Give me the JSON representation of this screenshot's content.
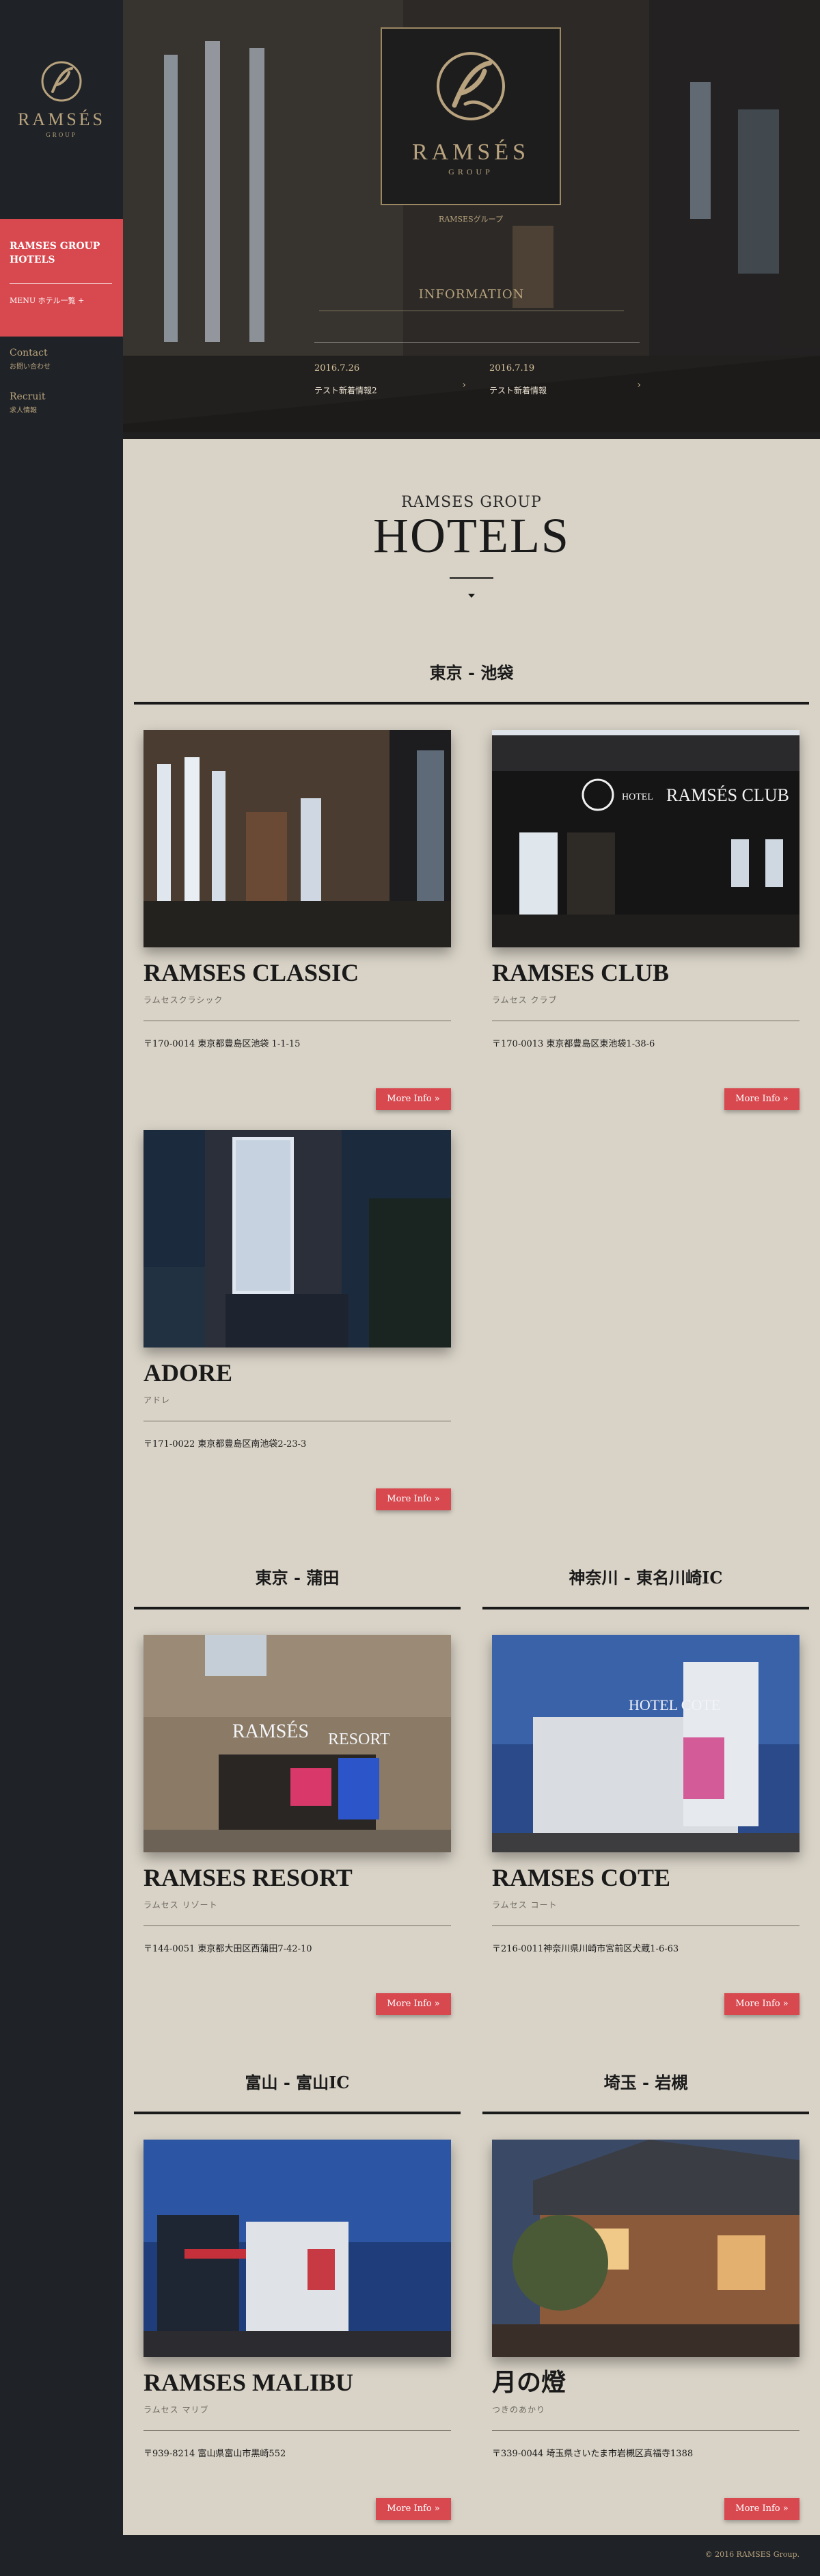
{
  "sidebar": {
    "logo_word": "RAMSÉS",
    "logo_sub": "GROUP",
    "active_title": "RAMSES GROUP HOTELS",
    "active_sub": "MENU ホテル一覧 +",
    "contact_en": "Contact",
    "contact_jp": "お問い合わせ",
    "recruit_en": "Recruit",
    "recruit_jp": "求人情報"
  },
  "hero": {
    "logo_word": "RAMSÉS",
    "logo_sub": "GROUP",
    "group_label": "RAMSESグループ",
    "info_title": "INFORMATION",
    "items": [
      {
        "date": "2016.7.26",
        "text": "テスト新着情報2"
      },
      {
        "date": "2016.7.19",
        "text": "テスト新着情報"
      }
    ]
  },
  "main": {
    "group_label": "RAMSES GROUP",
    "title": "HOTELS",
    "more_label": "More Info »",
    "areas": [
      {
        "title": "東京 - 池袋"
      },
      {
        "title": "東京 - 蒲田"
      },
      {
        "title": "神奈川 - 東名川崎IC"
      },
      {
        "title": "富山 - 富山IC"
      },
      {
        "title": "埼玉 - 岩槻"
      }
    ],
    "hotels": [
      {
        "name": "RAMSES CLASSIC",
        "kana": "ラムセスクラシック",
        "address": "〒170-0014 東京都豊島区池袋 1-1-15"
      },
      {
        "name": "RAMSES CLUB",
        "kana": "ラムセス クラブ",
        "address": "〒170-0013 東京都豊島区東池袋1-38-6"
      },
      {
        "name": "ADORE",
        "kana": "アドレ",
        "address": "〒171-0022 東京都豊島区南池袋2-23-3"
      },
      {
        "name": "RAMSES RESORT",
        "kana": "ラムセス リゾート",
        "address": "〒144-0051 東京都大田区西蒲田7-42-10"
      },
      {
        "name": "RAMSES COTE",
        "kana": "ラムセス コート",
        "address": "〒216-0011神奈川県川崎市宮前区犬蔵1-6-63"
      },
      {
        "name": "RAMSES MALIBU",
        "kana": "ラムセス マリブ",
        "address": "〒939-8214 富山県富山市黒崎552"
      },
      {
        "name": "月の燈",
        "kana": "つきのあかり",
        "address": "〒339-0044 埼玉県さいたま市岩槻区真福寺1388"
      }
    ]
  },
  "footer": {
    "copyright": "© 2016 RAMSES Group."
  }
}
